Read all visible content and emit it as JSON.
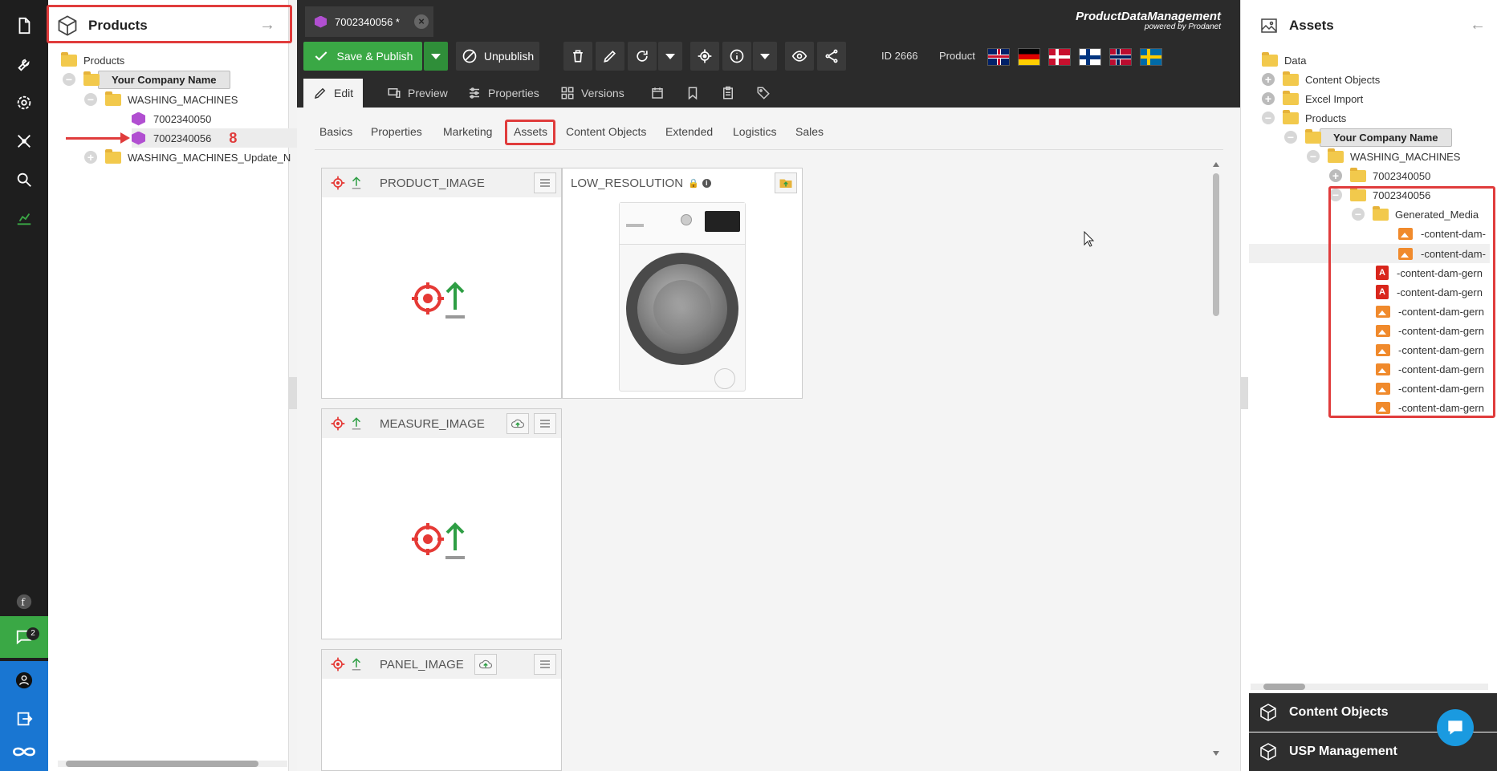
{
  "left_panel": {
    "title": "Products",
    "tree": {
      "root": "Products",
      "company": "Your Company Name",
      "folder1": "WASHING_MACHINES",
      "item1": "7002340050",
      "item2": "7002340056",
      "annotation_number": "8",
      "folder2": "WASHING_MACHINES_Update_N"
    }
  },
  "rail": {
    "chat_badge": "2"
  },
  "topbar": {
    "doc_tab_label": "7002340056 *",
    "brand_line1": "ProductDataManagement",
    "brand_line2": "powered by Prodanet",
    "save_publish": "Save & Publish",
    "unpublish": "Unpublish",
    "id_label": "ID 2666",
    "type_label": "Product",
    "subtabs": {
      "edit": "Edit",
      "preview": "Preview",
      "properties": "Properties",
      "versions": "Versions"
    }
  },
  "content_tabs": [
    "Basics",
    "Properties",
    "Marketing",
    "Assets",
    "Content Objects",
    "Extended",
    "Logistics",
    "Sales"
  ],
  "cards": {
    "product_image": "PRODUCT_IMAGE",
    "low_resolution": "LOW_RESOLUTION",
    "measure_image": "MEASURE_IMAGE",
    "panel_image": "PANEL_IMAGE"
  },
  "right_panel": {
    "title": "Assets",
    "tree": {
      "data": "Data",
      "content_objects": "Content Objects",
      "excel_import": "Excel Import",
      "products": "Products",
      "company": "Your Company Name",
      "washing": "WASHING_MACHINES",
      "item1": "7002340050",
      "item2": "7002340056",
      "generated": "Generated_Media",
      "gen_file1": "-content-dam-",
      "gen_file2": "-content-dam-",
      "files": [
        "-content-dam-gern",
        "-content-dam-gern",
        "-content-dam-gern",
        "-content-dam-gern",
        "-content-dam-gern",
        "-content-dam-gern",
        "-content-dam-gern",
        "-content-dam-gern"
      ]
    },
    "bottom1": "Content Objects",
    "bottom2": "USP Management"
  },
  "colors": {
    "accent_green": "#3aa845",
    "highlight_red": "#e03c3c",
    "rail_bg": "#1e1e1e",
    "topbar_bg": "#2b2b2b"
  }
}
